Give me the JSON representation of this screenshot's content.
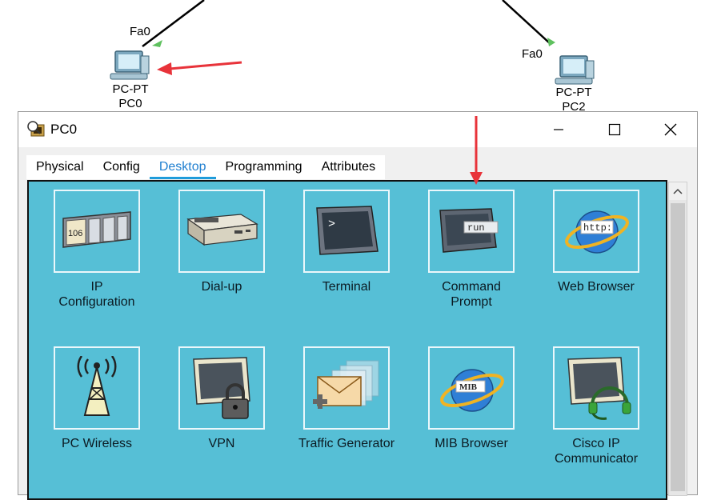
{
  "topology": {
    "pc0": {
      "port": "Fa0",
      "type": "PC-PT",
      "name": "PC0"
    },
    "pc2": {
      "port": "Fa0",
      "type": "PC-PT",
      "name": "PC2"
    }
  },
  "window": {
    "title": "PC0",
    "tabs": [
      {
        "label": "Physical"
      },
      {
        "label": "Config"
      },
      {
        "label": "Desktop",
        "active": true
      },
      {
        "label": "Programming"
      },
      {
        "label": "Attributes"
      }
    ]
  },
  "desktop": {
    "apps": [
      {
        "line1": "IP",
        "line2": "Configuration",
        "icon": "ip-config-icon"
      },
      {
        "line1": "Dial-up",
        "line2": "",
        "icon": "dialup-modem-icon"
      },
      {
        "line1": "Terminal",
        "line2": "",
        "icon": "terminal-icon"
      },
      {
        "line1": "Command",
        "line2": "Prompt",
        "icon": "command-prompt-icon"
      },
      {
        "line1": "Web Browser",
        "line2": "",
        "icon": "web-browser-icon"
      },
      {
        "line1": "PC Wireless",
        "line2": "",
        "icon": "wireless-tower-icon"
      },
      {
        "line1": "VPN",
        "line2": "",
        "icon": "vpn-lock-icon"
      },
      {
        "line1": "Traffic Generator",
        "line2": "",
        "icon": "traffic-generator-icon"
      },
      {
        "line1": "MIB Browser",
        "line2": "",
        "icon": "mib-browser-icon"
      },
      {
        "line1": "Cisco IP",
        "line2": "Communicator",
        "icon": "headset-icon"
      }
    ],
    "icon_texts": {
      "ip": "106",
      "terminal": ">",
      "cmd": "run",
      "web": "http:",
      "mib": "MIB"
    }
  },
  "colors": {
    "desktop_bg": "#56bfd6",
    "active_tab": "#1f7fd0",
    "arrow": "#e8333a",
    "link_light": "#5fc15f"
  }
}
